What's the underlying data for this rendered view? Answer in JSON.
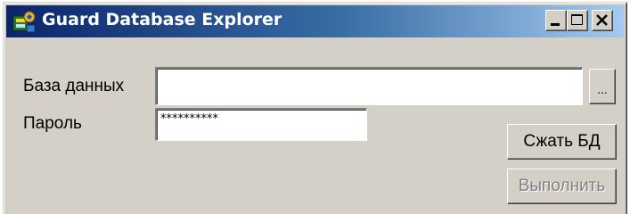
{
  "window": {
    "title": "Guard Database Explorer",
    "icon": "database-explorer-app-icon"
  },
  "caption_buttons": {
    "minimize_icon": "minimize-icon",
    "maximize_icon": "maximize-icon",
    "close_icon": "close-icon"
  },
  "form": {
    "database_label": "База данных",
    "database_value": "",
    "browse_button_label": "...",
    "password_label": "Пароль",
    "password_value": "**********"
  },
  "buttons": {
    "compress_label": "Сжать БД",
    "execute_label": "Выполнить",
    "execute_enabled": false
  },
  "colors": {
    "titlebar_start": "#0a246a",
    "titlebar_end": "#a6caf0",
    "face": "#d4d0c8",
    "disabled_text": "#808080"
  }
}
